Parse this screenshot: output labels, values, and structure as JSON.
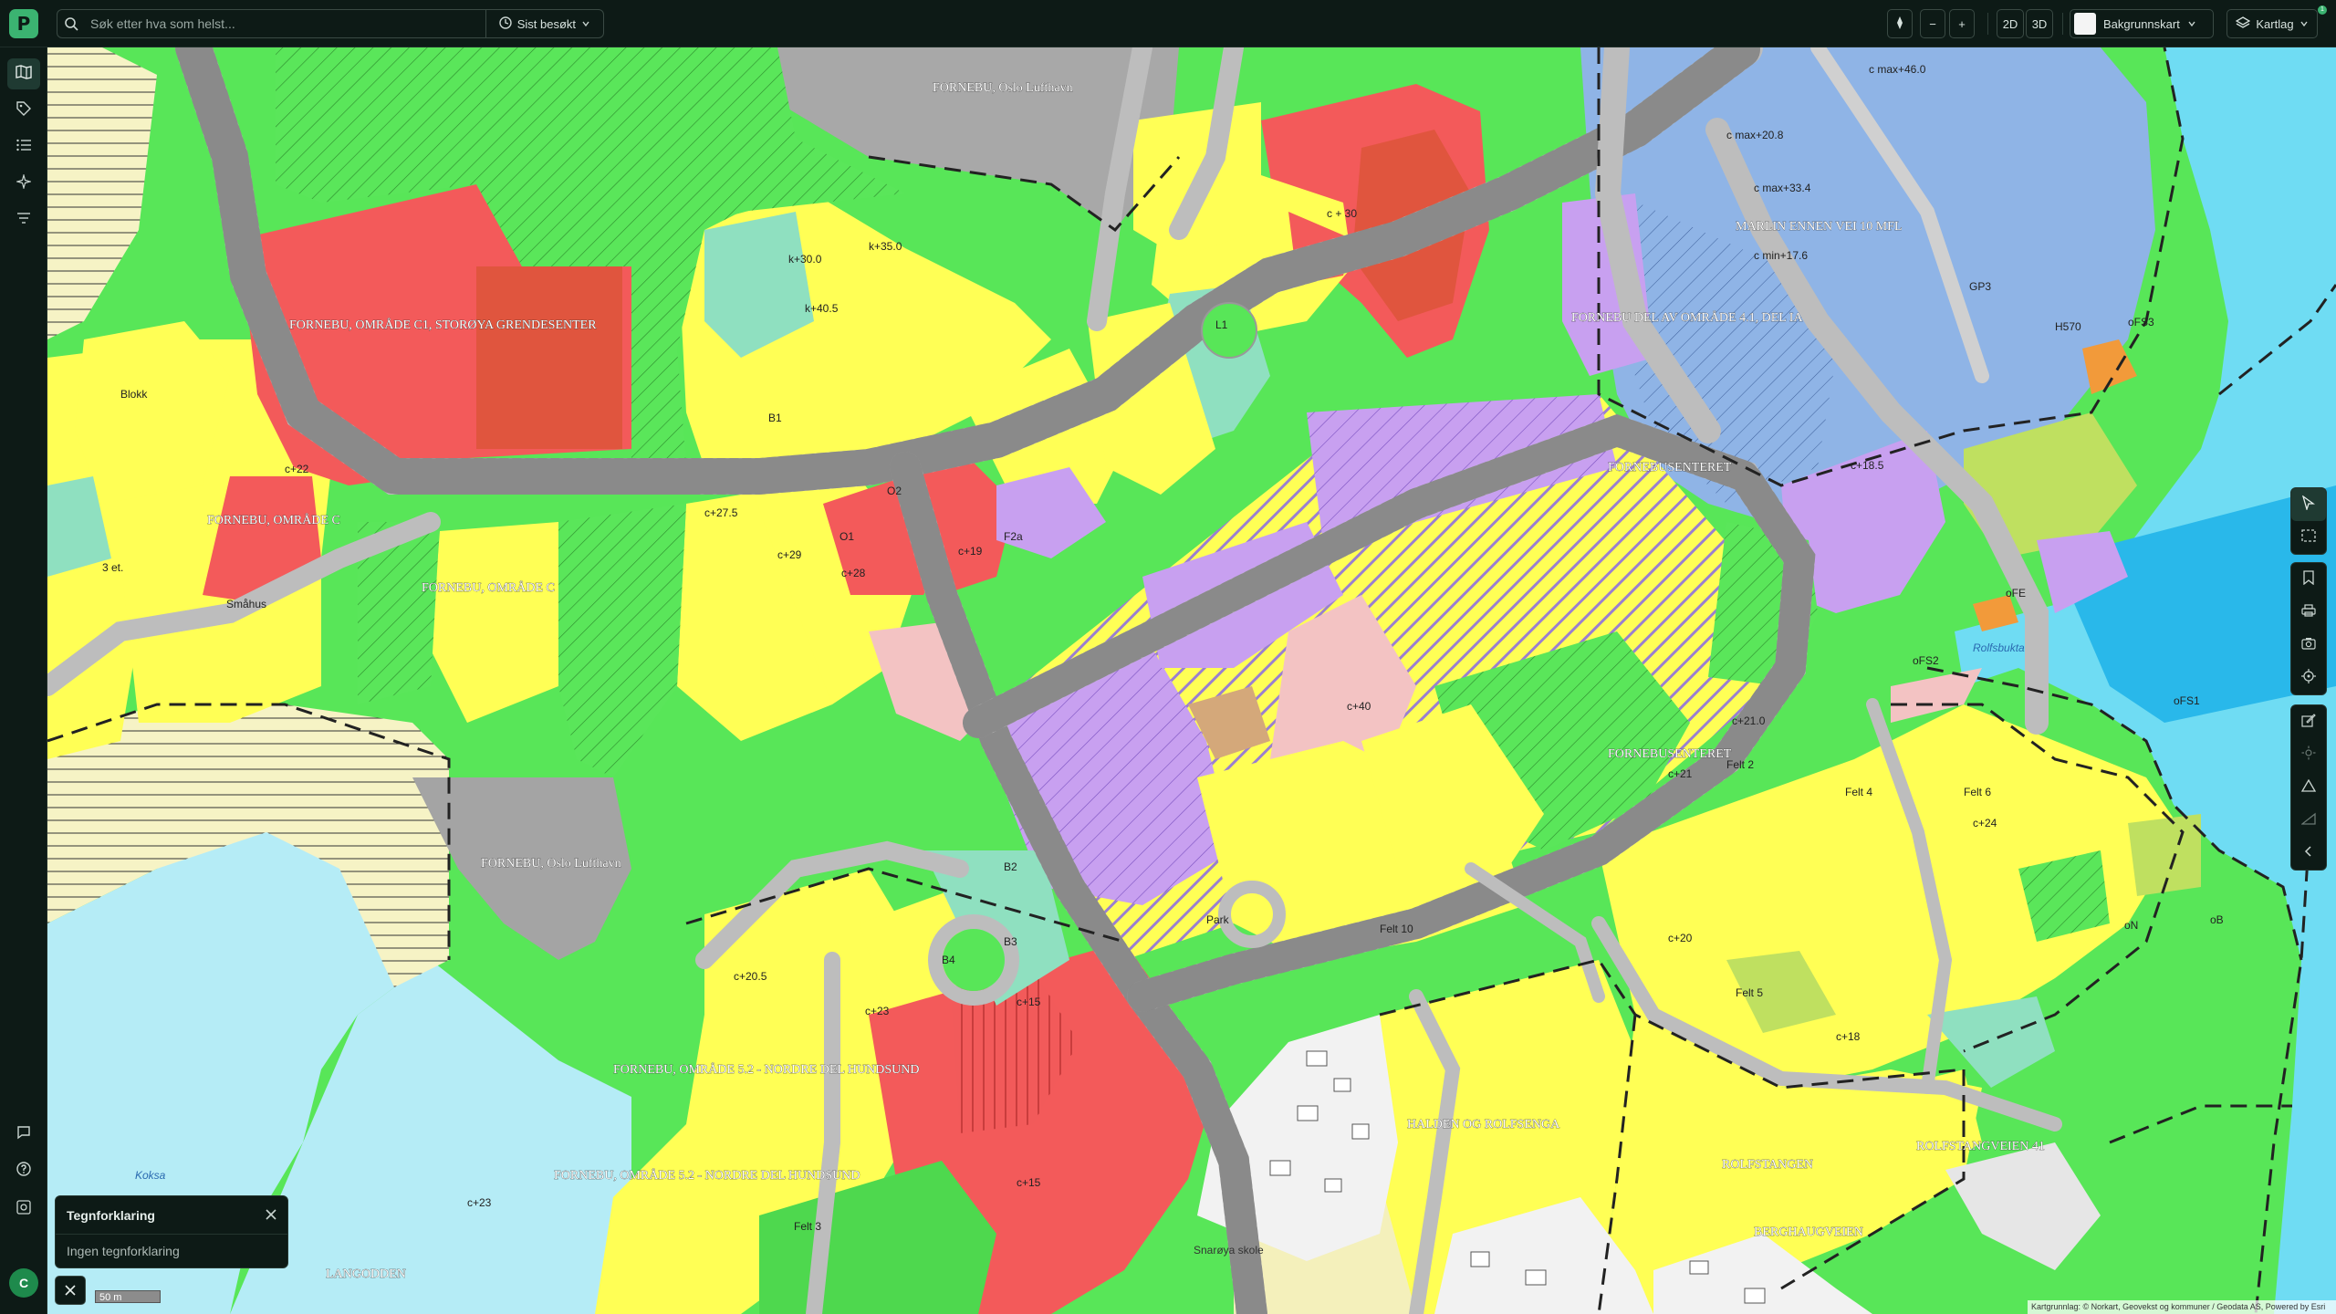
{
  "app": {
    "logo": "P",
    "notification_count": "1"
  },
  "search": {
    "placeholder": "Søk etter hva som helst...",
    "recent_label": "Sist besøkt"
  },
  "toolbar": {
    "zoom_out": "−",
    "zoom_in": "+",
    "view_2d": "2D",
    "view_3d": "3D",
    "basemap_label": "Bakgrunnskart",
    "layers_label": "Kartlag"
  },
  "legend": {
    "title": "Tegnforklaring",
    "empty_text": "Ingen tegnforklaring"
  },
  "scale": {
    "label": "50 m"
  },
  "user": {
    "initial": "C"
  },
  "attribution": {
    "text": "Kartgrunnlag: © Norkart, Geovekst og kommuner / Geodata AS, Powered by Esri"
  },
  "map_labels": {
    "fornebu_oslo_lufthavn_top": "FORNEBU, Oslo Lufthavn",
    "fornebu_omrade_c_storova": "FORNEBU, OMRÅDE C1, STORØYA GRENDESENTER",
    "fornebu_omrade_c_left": "FORNEBU, OMRÅDE C",
    "fornebu_omrade_c_mid": "FORNEBU, OMRÅDE C",
    "marlin": "MARLIN ENNEN VEI 10 MFL",
    "fornebu_del_omrade": "FORNEBU DEL AV OMRÅDE 4.1, DEL IA",
    "fornebusenter_a": "FORNEBUSENTERET",
    "fornebusenter_b": "FORNEBUSENTERET",
    "fornebu_oslo_lufthavn_low": "FORNEBU, Oslo Lufthavn",
    "fornebu_52_a": "FORNEBU, OMRÅDE 5.2 - NORDRE DEL HUNDSUND",
    "fornebu_52_b": "FORNEBU, OMRÅDE 5.2 - NORDRE DEL HUNDSUND",
    "halden": "HALDEN OG ROLFSENGA",
    "rolfstangen": "ROLFSTANGEN",
    "rolfstangveien": "ROLFSTANGVEIEN 41",
    "berghaugveien": "BERGHAUGVEIEN",
    "langodden": "LANGODDEN",
    "koksa": "Koksa",
    "rolfsbukta": "Rolfsbukta",
    "snaroya_skole": "Snarøya skole",
    "ofs3": "oFS3",
    "ofs2": "oFS2",
    "ofs1": "oFS1",
    "ofe": "oFE",
    "ob": "oB",
    "on": "oN",
    "gp3": "GP3",
    "h570": "H570",
    "felt3": "Felt 3",
    "felt5": "Felt 5",
    "felt6": "Felt 6",
    "felt4": "Felt 4",
    "felt2": "Felt 2",
    "felt10": "Felt 10",
    "c20": "c+20",
    "c15": "c+15",
    "c15b": "c+15",
    "c21": "c+21",
    "c21b": "c+21.0",
    "c24": "c+24",
    "c18": "c+18",
    "c23": "c+23",
    "c22": "c+22",
    "c205": "c+20.5",
    "c185": "c+18.5",
    "c28": "c+28",
    "c29": "c+29",
    "c19": "c+19",
    "c275": "c+27.5",
    "c23b": "c+23",
    "c40": "c+40",
    "cmax208": "c max+20.8",
    "cmax46": "c max+46.0",
    "cmax334": "c max+33.4",
    "cmin176": "c min+17.6",
    "c30": "c + 30",
    "k350": "k+35.0",
    "k300": "k+30.0",
    "k405": "k+40.5",
    "blokk": "Blokk",
    "smahus": "Småhus",
    "ret": "3 et.",
    "park": "Park",
    "b2": "B2",
    "b3": "B3",
    "b4": "B4",
    "b1": "B1",
    "l1": "L1",
    "f2a": "F2a",
    "o2": "O2",
    "o1": "O1"
  }
}
